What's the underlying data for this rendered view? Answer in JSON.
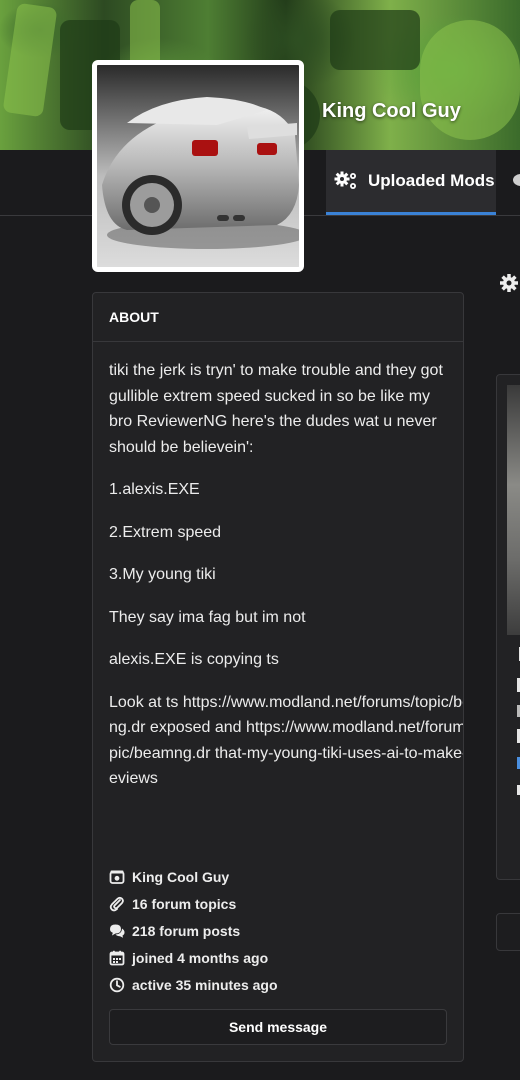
{
  "profile": {
    "name": "King Cool Guy",
    "avatar_alt": "car-photo"
  },
  "tabs": [
    {
      "label": "Uploaded Mods",
      "icon": "gears-icon",
      "active": true
    }
  ],
  "about": {
    "heading": "ABOUT",
    "paragraphs": [
      " tiki the jerk is tryn' to make trouble and they got gullible extrem speed sucked in so be like my bro ReviewerNG here's the dudes wat u never should be believein':",
      "1.alexis.EXE",
      "2.Extrem speed",
      "3.My young tiki",
      "They say ima fag but im not",
      "alexis.EXE is copying ts",
      "Look at ts https://www.modland.net/forums/topic/beamng.dr exposed and https://www.modland.net/forums/topic/beamng.dr that-my-young-tiki-uses-ai-to-make-his-reviews"
    ],
    "stats": {
      "username": "King Cool Guy",
      "forum_topics": "16 forum topics",
      "forum_posts": "218 forum posts",
      "joined": "joined 4 months ago",
      "active": "active 35 minutes ago"
    },
    "send_message_label": "Send message"
  },
  "colors": {
    "background": "#1b1b1d",
    "card": "#222224",
    "tab_active_underline": "#3a82d6",
    "text": "#e6e6e6"
  }
}
